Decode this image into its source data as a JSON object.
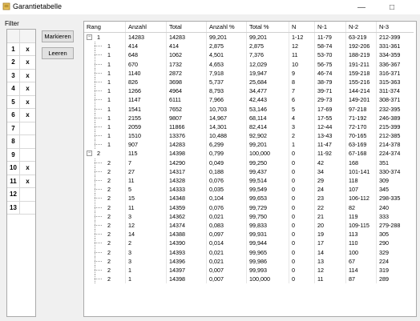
{
  "window": {
    "title": "Garantietabelle"
  },
  "filter": {
    "label": "Filter",
    "rows": [
      {
        "num": "1",
        "mark": "x"
      },
      {
        "num": "2",
        "mark": "x"
      },
      {
        "num": "3",
        "mark": "x"
      },
      {
        "num": "4",
        "mark": "x"
      },
      {
        "num": "5",
        "mark": "x"
      },
      {
        "num": "6",
        "mark": "x"
      },
      {
        "num": "7",
        "mark": ""
      },
      {
        "num": "8",
        "mark": ""
      },
      {
        "num": "9",
        "mark": ""
      },
      {
        "num": "10",
        "mark": "x"
      },
      {
        "num": "11",
        "mark": "x"
      },
      {
        "num": "12",
        "mark": ""
      },
      {
        "num": "13",
        "mark": ""
      }
    ]
  },
  "buttons": {
    "mark": "Markieren",
    "clear": "Leeren"
  },
  "table": {
    "headers": [
      "Rang",
      "Anzahl",
      "Total",
      "Anzahl %",
      "Total %",
      "N",
      "N-1",
      "N-2",
      "N-3"
    ],
    "rows": [
      {
        "level": 0,
        "toggle": "−",
        "rang": "1",
        "anzahl": "14283",
        "total": "14283",
        "anzp": "99,201",
        "totp": "99,201",
        "n": "1-12",
        "n1": "11-79",
        "n2": "63-219",
        "n3": "212-399"
      },
      {
        "level": 1,
        "rang": "1",
        "anzahl": "414",
        "total": "414",
        "anzp": "2,875",
        "totp": "2,875",
        "n": "12",
        "n1": "58-74",
        "n2": "192-206",
        "n3": "331-361"
      },
      {
        "level": 1,
        "rang": "1",
        "anzahl": "648",
        "total": "1062",
        "anzp": "4,501",
        "totp": "7,376",
        "n": "11",
        "n1": "53-70",
        "n2": "188-219",
        "n3": "334-359"
      },
      {
        "level": 1,
        "rang": "1",
        "anzahl": "670",
        "total": "1732",
        "anzp": "4,653",
        "totp": "12,029",
        "n": "10",
        "n1": "56-75",
        "n2": "191-211",
        "n3": "336-367"
      },
      {
        "level": 1,
        "rang": "1",
        "anzahl": "1140",
        "total": "2872",
        "anzp": "7,918",
        "totp": "19,947",
        "n": "9",
        "n1": "46-74",
        "n2": "159-218",
        "n3": "316-371"
      },
      {
        "level": 1,
        "rang": "1",
        "anzahl": "826",
        "total": "3698",
        "anzp": "5,737",
        "totp": "25,684",
        "n": "8",
        "n1": "38-79",
        "n2": "155-216",
        "n3": "315-363"
      },
      {
        "level": 1,
        "rang": "1",
        "anzahl": "1266",
        "total": "4964",
        "anzp": "8,793",
        "totp": "34,477",
        "n": "7",
        "n1": "39-71",
        "n2": "144-214",
        "n3": "311-374"
      },
      {
        "level": 1,
        "rang": "1",
        "anzahl": "1147",
        "total": "6111",
        "anzp": "7,966",
        "totp": "42,443",
        "n": "6",
        "n1": "29-73",
        "n2": "149-201",
        "n3": "308-371"
      },
      {
        "level": 1,
        "rang": "1",
        "anzahl": "1541",
        "total": "7652",
        "anzp": "10,703",
        "totp": "53,146",
        "n": "5",
        "n1": "17-69",
        "n2": "97-218",
        "n3": "232-395"
      },
      {
        "level": 1,
        "rang": "1",
        "anzahl": "2155",
        "total": "9807",
        "anzp": "14,967",
        "totp": "68,114",
        "n": "4",
        "n1": "17-55",
        "n2": "71-192",
        "n3": "246-389"
      },
      {
        "level": 1,
        "rang": "1",
        "anzahl": "2059",
        "total": "11866",
        "anzp": "14,301",
        "totp": "82,414",
        "n": "3",
        "n1": "12-44",
        "n2": "72-170",
        "n3": "215-399"
      },
      {
        "level": 1,
        "rang": "1",
        "anzahl": "1510",
        "total": "13376",
        "anzp": "10,488",
        "totp": "92,902",
        "n": "2",
        "n1": "13-43",
        "n2": "70-165",
        "n3": "212-385"
      },
      {
        "level": 1,
        "rang": "1",
        "anzahl": "907",
        "total": "14283",
        "anzp": "6,299",
        "totp": "99,201",
        "n": "1",
        "n1": "11-47",
        "n2": "63-169",
        "n3": "214-378"
      },
      {
        "level": 0,
        "toggle": "−",
        "rang": "2",
        "anzahl": "115",
        "total": "14398",
        "anzp": "0,799",
        "totp": "100,000",
        "n": "0",
        "n1": "11-92",
        "n2": "67-168",
        "n3": "224-374"
      },
      {
        "level": 1,
        "rang": "2",
        "anzahl": "7",
        "total": "14290",
        "anzp": "0,049",
        "totp": "99,250",
        "n": "0",
        "n1": "42",
        "n2": "168",
        "n3": "351"
      },
      {
        "level": 1,
        "rang": "2",
        "anzahl": "27",
        "total": "14317",
        "anzp": "0,188",
        "totp": "99,437",
        "n": "0",
        "n1": "34",
        "n2": "101-141",
        "n3": "330-374"
      },
      {
        "level": 1,
        "rang": "2",
        "anzahl": "11",
        "total": "14328",
        "anzp": "0,076",
        "totp": "99,514",
        "n": "0",
        "n1": "29",
        "n2": "118",
        "n3": "309"
      },
      {
        "level": 1,
        "rang": "2",
        "anzahl": "5",
        "total": "14333",
        "anzp": "0,035",
        "totp": "99,549",
        "n": "0",
        "n1": "24",
        "n2": "107",
        "n3": "345"
      },
      {
        "level": 1,
        "rang": "2",
        "anzahl": "15",
        "total": "14348",
        "anzp": "0,104",
        "totp": "99,653",
        "n": "0",
        "n1": "23",
        "n2": "106-112",
        "n3": "298-335"
      },
      {
        "level": 1,
        "rang": "2",
        "anzahl": "11",
        "total": "14359",
        "anzp": "0,076",
        "totp": "99,729",
        "n": "0",
        "n1": "22",
        "n2": "82",
        "n3": "240"
      },
      {
        "level": 1,
        "rang": "2",
        "anzahl": "3",
        "total": "14362",
        "anzp": "0,021",
        "totp": "99,750",
        "n": "0",
        "n1": "21",
        "n2": "119",
        "n3": "333"
      },
      {
        "level": 1,
        "rang": "2",
        "anzahl": "12",
        "total": "14374",
        "anzp": "0,083",
        "totp": "99,833",
        "n": "0",
        "n1": "20",
        "n2": "109-115",
        "n3": "279-288"
      },
      {
        "level": 1,
        "rang": "2",
        "anzahl": "14",
        "total": "14388",
        "anzp": "0,097",
        "totp": "99,931",
        "n": "0",
        "n1": "19",
        "n2": "113",
        "n3": "305"
      },
      {
        "level": 1,
        "rang": "2",
        "anzahl": "2",
        "total": "14390",
        "anzp": "0,014",
        "totp": "99,944",
        "n": "0",
        "n1": "17",
        "n2": "110",
        "n3": "290"
      },
      {
        "level": 1,
        "rang": "2",
        "anzahl": "3",
        "total": "14393",
        "anzp": "0,021",
        "totp": "99,965",
        "n": "0",
        "n1": "14",
        "n2": "100",
        "n3": "329"
      },
      {
        "level": 1,
        "rang": "2",
        "anzahl": "3",
        "total": "14396",
        "anzp": "0,021",
        "totp": "99,986",
        "n": "0",
        "n1": "13",
        "n2": "67",
        "n3": "224"
      },
      {
        "level": 1,
        "rang": "2",
        "anzahl": "1",
        "total": "14397",
        "anzp": "0,007",
        "totp": "99,993",
        "n": "0",
        "n1": "12",
        "n2": "114",
        "n3": "319"
      },
      {
        "level": 1,
        "rang": "2",
        "anzahl": "1",
        "total": "14398",
        "anzp": "0,007",
        "totp": "100,000",
        "n": "0",
        "n1": "11",
        "n2": "87",
        "n3": "289"
      }
    ]
  }
}
